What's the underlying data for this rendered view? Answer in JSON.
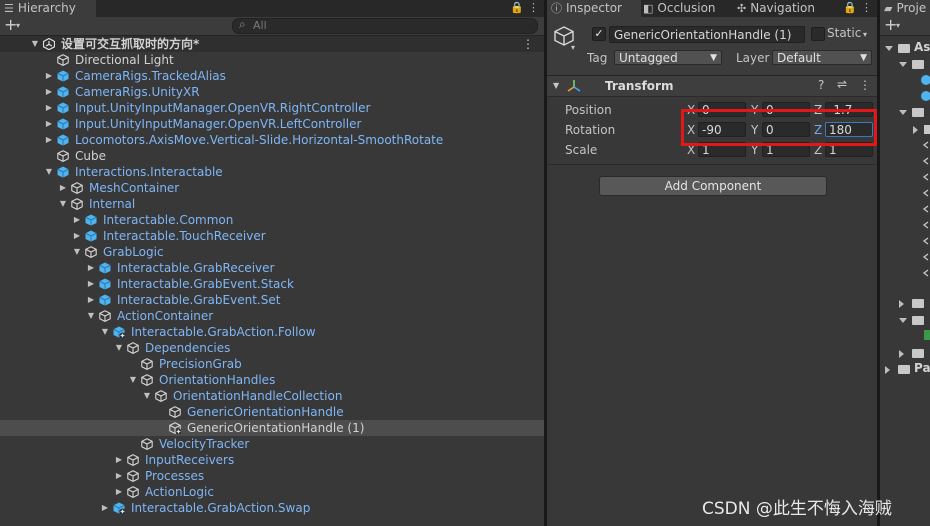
{
  "hierarchy": {
    "tab_label": "Hierarchy",
    "search_placeholder": "All",
    "rows": [
      {
        "label": "设置可交互抓取时的方向*",
        "indent": 0,
        "fold": "open",
        "icon": "unity",
        "style": "bold",
        "scene": true
      },
      {
        "label": "Directional Light",
        "indent": 1,
        "fold": "",
        "icon": "go",
        "style": "plain"
      },
      {
        "label": "CameraRigs.TrackedAlias",
        "indent": 1,
        "fold": "closed",
        "icon": "prefab",
        "style": "prefab"
      },
      {
        "label": "CameraRigs.UnityXR",
        "indent": 1,
        "fold": "closed",
        "icon": "prefab",
        "style": "prefab"
      },
      {
        "label": "Input.UnityInputManager.OpenVR.RightController",
        "indent": 1,
        "fold": "closed",
        "icon": "prefab",
        "style": "prefab"
      },
      {
        "label": "Input.UnityInputManager.OpenVR.LeftController",
        "indent": 1,
        "fold": "closed",
        "icon": "prefab",
        "style": "prefab"
      },
      {
        "label": "Locomotors.AxisMove.Vertical-Slide.Horizontal-SmoothRotate",
        "indent": 1,
        "fold": "closed",
        "icon": "prefab",
        "style": "prefab"
      },
      {
        "label": "Cube",
        "indent": 1,
        "fold": "",
        "icon": "go",
        "style": "plain"
      },
      {
        "label": "Interactions.Interactable",
        "indent": 1,
        "fold": "open",
        "icon": "prefab",
        "style": "prefab"
      },
      {
        "label": "MeshContainer",
        "indent": 2,
        "fold": "closed",
        "icon": "go",
        "style": "prefab"
      },
      {
        "label": "Internal",
        "indent": 2,
        "fold": "open",
        "icon": "go",
        "style": "prefab"
      },
      {
        "label": "Interactable.Common",
        "indent": 3,
        "fold": "closed",
        "icon": "prefab",
        "style": "prefab"
      },
      {
        "label": "Interactable.TouchReceiver",
        "indent": 3,
        "fold": "closed",
        "icon": "prefab",
        "style": "prefab"
      },
      {
        "label": "GrabLogic",
        "indent": 3,
        "fold": "open",
        "icon": "go",
        "style": "prefab"
      },
      {
        "label": "Interactable.GrabReceiver",
        "indent": 4,
        "fold": "closed",
        "icon": "prefab",
        "style": "prefab"
      },
      {
        "label": "Interactable.GrabEvent.Stack",
        "indent": 4,
        "fold": "closed",
        "icon": "prefab",
        "style": "prefab"
      },
      {
        "label": "Interactable.GrabEvent.Set",
        "indent": 4,
        "fold": "closed",
        "icon": "prefab",
        "style": "prefab"
      },
      {
        "label": "ActionContainer",
        "indent": 4,
        "fold": "open",
        "icon": "go",
        "style": "prefab"
      },
      {
        "label": "Interactable.GrabAction.Follow",
        "indent": 5,
        "fold": "open",
        "icon": "prefab-added",
        "style": "prefab"
      },
      {
        "label": "Dependencies",
        "indent": 6,
        "fold": "open",
        "icon": "go",
        "style": "prefab"
      },
      {
        "label": "PrecisionGrab",
        "indent": 7,
        "fold": "",
        "icon": "go",
        "style": "prefab"
      },
      {
        "label": "OrientationHandles",
        "indent": 7,
        "fold": "open",
        "icon": "go",
        "style": "prefab"
      },
      {
        "label": "OrientationHandleCollection",
        "indent": 8,
        "fold": "open",
        "icon": "go",
        "style": "prefab"
      },
      {
        "label": "GenericOrientationHandle",
        "indent": 9,
        "fold": "",
        "icon": "go",
        "style": "prefab"
      },
      {
        "label": "GenericOrientationHandle (1)",
        "indent": 9,
        "fold": "",
        "icon": "go-added",
        "style": "plain",
        "selected": true
      },
      {
        "label": "VelocityTracker",
        "indent": 7,
        "fold": "",
        "icon": "go",
        "style": "prefab"
      },
      {
        "label": "InputReceivers",
        "indent": 6,
        "fold": "closed",
        "icon": "go",
        "style": "prefab"
      },
      {
        "label": "Processes",
        "indent": 6,
        "fold": "closed",
        "icon": "go",
        "style": "prefab"
      },
      {
        "label": "ActionLogic",
        "indent": 6,
        "fold": "closed",
        "icon": "go",
        "style": "prefab"
      },
      {
        "label": "Interactable.GrabAction.Swap",
        "indent": 5,
        "fold": "closed",
        "icon": "prefab-added",
        "style": "prefab"
      }
    ]
  },
  "inspector": {
    "tabs": [
      "Inspector",
      "Occlusion",
      "Navigation"
    ],
    "object_name": "GenericOrientationHandle (1)",
    "static_label": "Static",
    "tag_label": "Tag",
    "tag_value": "Untagged",
    "layer_label": "Layer",
    "layer_value": "Default",
    "component_title": "Transform",
    "position_label": "Position",
    "rotation_label": "Rotation",
    "scale_label": "Scale",
    "position": {
      "x": "0",
      "y": "0",
      "z": "-1.7"
    },
    "rotation": {
      "x": "-90",
      "y": "0",
      "z": "180"
    },
    "scale": {
      "x": "1",
      "y": "1",
      "z": "1"
    },
    "add_component": "Add Component"
  },
  "project": {
    "tab_label": "Proje",
    "root_label": "As",
    "bottom_label": "Pa"
  },
  "watermark": "CSDN @此生不悔入海贼",
  "colors": {
    "accent_blue": "#7fb6f5",
    "highlight_red": "#e3161a",
    "prefab_icon": "#4fb3f0"
  }
}
